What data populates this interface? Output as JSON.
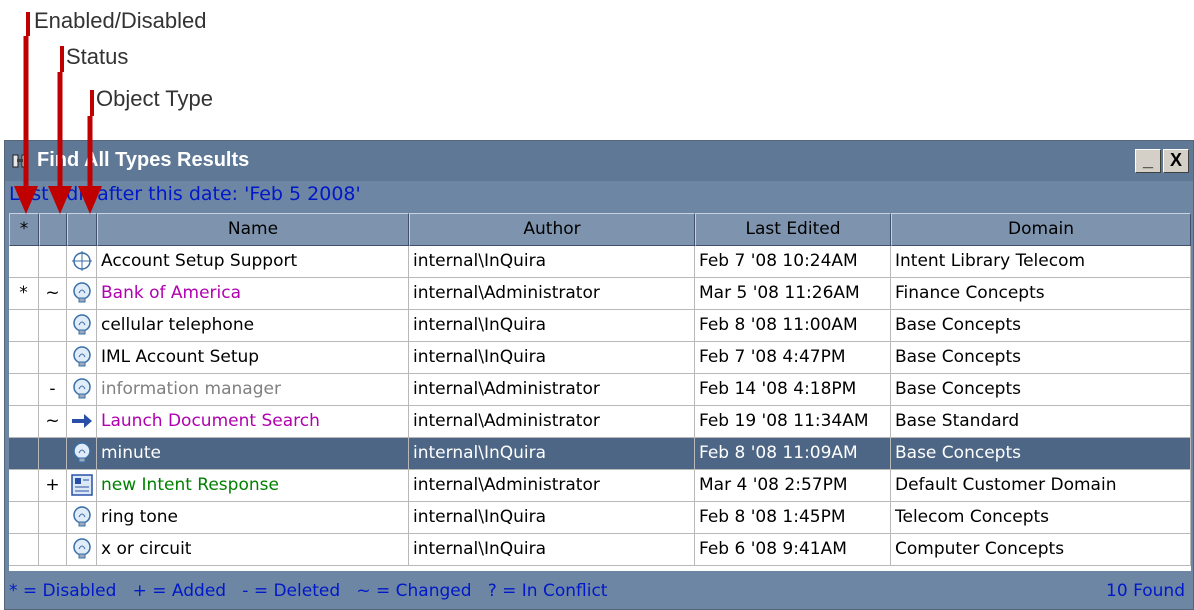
{
  "annotations": {
    "enabled_disabled": "Enabled/Disabled",
    "status": "Status",
    "object_type": "Object Type",
    "arrow_color": "#c00000"
  },
  "window": {
    "title": "Find All Types Results",
    "minimize_label": "_",
    "close_label": "X",
    "filter_text": "Last edit after this date: 'Feb 5 2008'"
  },
  "table": {
    "columns": {
      "enabled": "*",
      "status": "",
      "type": "",
      "name": "Name",
      "author": "Author",
      "last_edited": "Last Edited",
      "domain": "Domain"
    },
    "rows": [
      {
        "enabled": "",
        "status": "",
        "icon": "crosshair-icon",
        "name": "Account Setup Support",
        "name_color": "#000000",
        "author": "internal\\InQuira",
        "last_edited": "Feb 7 '08 10:24AM",
        "domain": "Intent Library Telecom",
        "selected": false
      },
      {
        "enabled": "*",
        "status": "~",
        "icon": "lightbulb-icon",
        "name": "Bank of America",
        "name_color": "#b000b0",
        "author": "internal\\Administrator",
        "last_edited": "Mar 5 '08 11:26AM",
        "domain": "Finance Concepts",
        "selected": false
      },
      {
        "enabled": "",
        "status": "",
        "icon": "lightbulb-icon",
        "name": "cellular telephone",
        "name_color": "#000000",
        "author": "internal\\InQuira",
        "last_edited": "Feb 8 '08 11:00AM",
        "domain": "Base Concepts",
        "selected": false
      },
      {
        "enabled": "",
        "status": "",
        "icon": "lightbulb-icon",
        "name": "IML Account Setup",
        "name_color": "#000000",
        "author": "internal\\InQuira",
        "last_edited": "Feb 7 '08 4:47PM",
        "domain": "Base Concepts",
        "selected": false
      },
      {
        "enabled": "",
        "status": "-",
        "icon": "lightbulb-icon",
        "name": "information manager",
        "name_color": "#808080",
        "author": "internal\\Administrator",
        "last_edited": "Feb 14 '08 4:18PM",
        "domain": "Base Concepts",
        "selected": false
      },
      {
        "enabled": "",
        "status": "~",
        "icon": "arrow-icon",
        "name": "Launch Document Search",
        "name_color": "#b000b0",
        "author": "internal\\Administrator",
        "last_edited": "Feb 19 '08 11:34AM",
        "domain": "Base Standard",
        "selected": false
      },
      {
        "enabled": "",
        "status": "",
        "icon": "lightbulb-icon",
        "name": "minute",
        "name_color": "#ffffff",
        "author": "internal\\InQuira",
        "last_edited": "Feb 8 '08 11:09AM",
        "domain": "Base Concepts",
        "selected": true
      },
      {
        "enabled": "",
        "status": "+",
        "icon": "response-icon",
        "name": "new Intent Response",
        "name_color": "#008000",
        "author": "internal\\Administrator",
        "last_edited": "Mar 4 '08 2:57PM",
        "domain": "Default Customer Domain",
        "selected": false
      },
      {
        "enabled": "",
        "status": "",
        "icon": "lightbulb-icon",
        "name": "ring tone",
        "name_color": "#000000",
        "author": "internal\\InQuira",
        "last_edited": "Feb 8 '08 1:45PM",
        "domain": "Telecom Concepts",
        "selected": false
      },
      {
        "enabled": "",
        "status": "",
        "icon": "lightbulb-icon",
        "name": "x or circuit",
        "name_color": "#000000",
        "author": "internal\\InQuira",
        "last_edited": "Feb 6 '08 9:41AM",
        "domain": "Computer Concepts",
        "selected": false
      }
    ]
  },
  "statusbar": {
    "legend": "* = Disabled   + = Added   - = Deleted   ~ = Changed   ? = In Conflict",
    "found": "10 Found"
  }
}
